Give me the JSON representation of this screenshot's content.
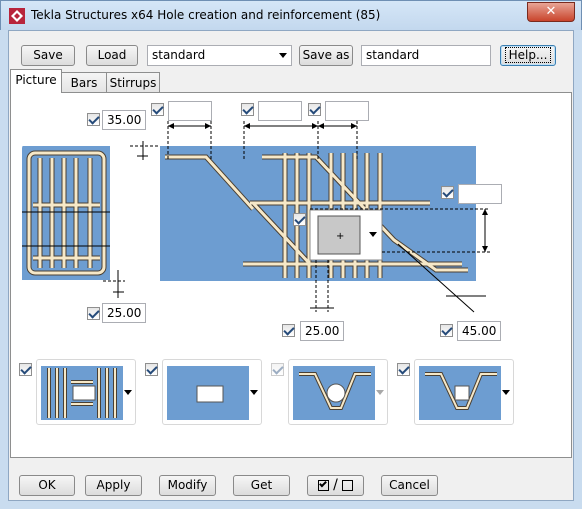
{
  "window": {
    "title": "Tekla Structures x64  Hole creation and reinforcement (85)"
  },
  "toolbar": {
    "save_label": "Save",
    "load_label": "Load",
    "preset_value": "standard",
    "save_as_label": "Save as",
    "save_as_value": "standard",
    "help_label": "Help..."
  },
  "tabs": [
    {
      "label": "Picture"
    },
    {
      "label": "Bars"
    },
    {
      "label": "Stirrups"
    }
  ],
  "picture": {
    "field_top_left": "35.00",
    "field_bottom_left": "25.00",
    "field_top_a": "",
    "field_top_b": "",
    "field_top_c": "",
    "field_right": "",
    "field_bottom_mid": "25.00",
    "field_bottom_right": "45.00"
  },
  "colors": {
    "plate": "#6d9dd1",
    "rebar": "#f6e8c8",
    "rebar_edge": "#4a4033"
  },
  "footer": {
    "ok_label": "OK",
    "apply_label": "Apply",
    "modify_label": "Modify",
    "get_label": "Get",
    "toggle_label": "/",
    "cancel_label": "Cancel"
  }
}
